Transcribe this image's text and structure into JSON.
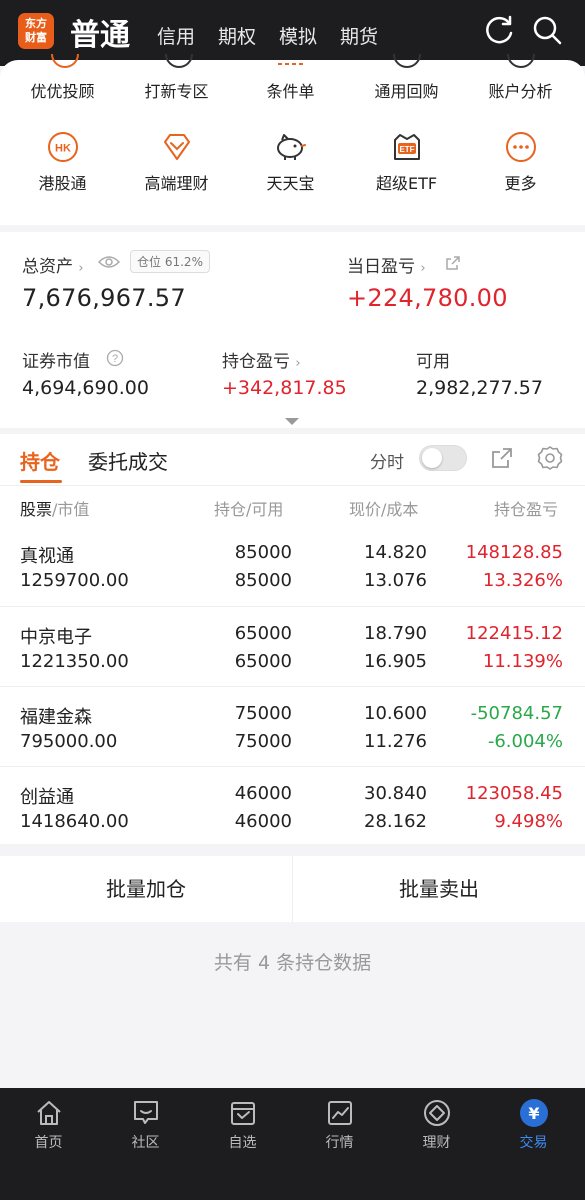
{
  "header": {
    "logo_text": "东方财富",
    "main_tab": "普通",
    "sub_tabs": [
      "信用",
      "期权",
      "模拟",
      "期货"
    ],
    "icons": [
      "refresh-icon",
      "search-icon"
    ]
  },
  "menu": {
    "row1": [
      {
        "label": "优优投顾"
      },
      {
        "label": "打新专区"
      },
      {
        "label": "条件单"
      },
      {
        "label": "通用回购"
      },
      {
        "label": "账户分析"
      }
    ],
    "row2": [
      {
        "label": "港股通",
        "icon": "hk-icon",
        "icon_text": "HK"
      },
      {
        "label": "高端理财",
        "icon": "diamond-icon"
      },
      {
        "label": "天天宝",
        "icon": "piggy-bank-icon"
      },
      {
        "label": "超级ETF",
        "icon": "etf-icon",
        "icon_text": "ETF"
      },
      {
        "label": "更多",
        "icon": "more-icon"
      }
    ]
  },
  "assets": {
    "total_label": "总资产",
    "position_label": "仓位",
    "position_value": "61.2%",
    "total_value": "7,676,967.57",
    "daily_pl_label": "当日盈亏",
    "daily_pl_value": "+224,780.00",
    "market_value_label": "证券市值",
    "market_value": "4,694,690.00",
    "holding_pl_label": "持仓盈亏",
    "holding_pl_value": "+342,817.85",
    "available_label": "可用",
    "available_value": "2,982,277.57"
  },
  "tabs": {
    "active": "持仓",
    "inactive": "委托成交",
    "fenshi_label": "分时"
  },
  "table": {
    "headers": {
      "stock": "股票",
      "market_value": "/市值",
      "qty": "持仓",
      "available": "/可用",
      "price": "现价",
      "cost": "/成本",
      "pl": "持仓盈亏"
    },
    "rows": [
      {
        "name": "真视通",
        "value": "1259700.00",
        "qty": "85000",
        "avail": "85000",
        "price": "14.820",
        "cost": "13.076",
        "pl": "148128.85",
        "pl_pct": "13.326%",
        "trend": "up"
      },
      {
        "name": "中京电子",
        "value": "1221350.00",
        "qty": "65000",
        "avail": "65000",
        "price": "18.790",
        "cost": "16.905",
        "pl": "122415.12",
        "pl_pct": "11.139%",
        "trend": "up"
      },
      {
        "name": "福建金森",
        "value": "795000.00",
        "qty": "75000",
        "avail": "75000",
        "price": "10.600",
        "cost": "11.276",
        "pl": "-50784.57",
        "pl_pct": "-6.004%",
        "trend": "down"
      },
      {
        "name": "创益通",
        "value": "1418640.00",
        "qty": "46000",
        "avail": "46000",
        "price": "30.840",
        "cost": "28.162",
        "pl": "123058.45",
        "pl_pct": "9.498%",
        "trend": "up"
      }
    ]
  },
  "batch": {
    "add": "批量加仓",
    "sell": "批量卖出"
  },
  "summary": "共有 4 条持仓数据",
  "nav": [
    {
      "label": "首页",
      "icon": "home-icon"
    },
    {
      "label": "社区",
      "icon": "community-icon"
    },
    {
      "label": "自选",
      "icon": "watchlist-icon"
    },
    {
      "label": "行情",
      "icon": "market-icon"
    },
    {
      "label": "理财",
      "icon": "finance-icon"
    },
    {
      "label": "交易",
      "icon": "trade-icon",
      "active": true
    }
  ],
  "colors": {
    "accent": "#e8641e",
    "up": "#e0232c",
    "down": "#2aa84a",
    "trade_active": "#2a6fd6"
  }
}
